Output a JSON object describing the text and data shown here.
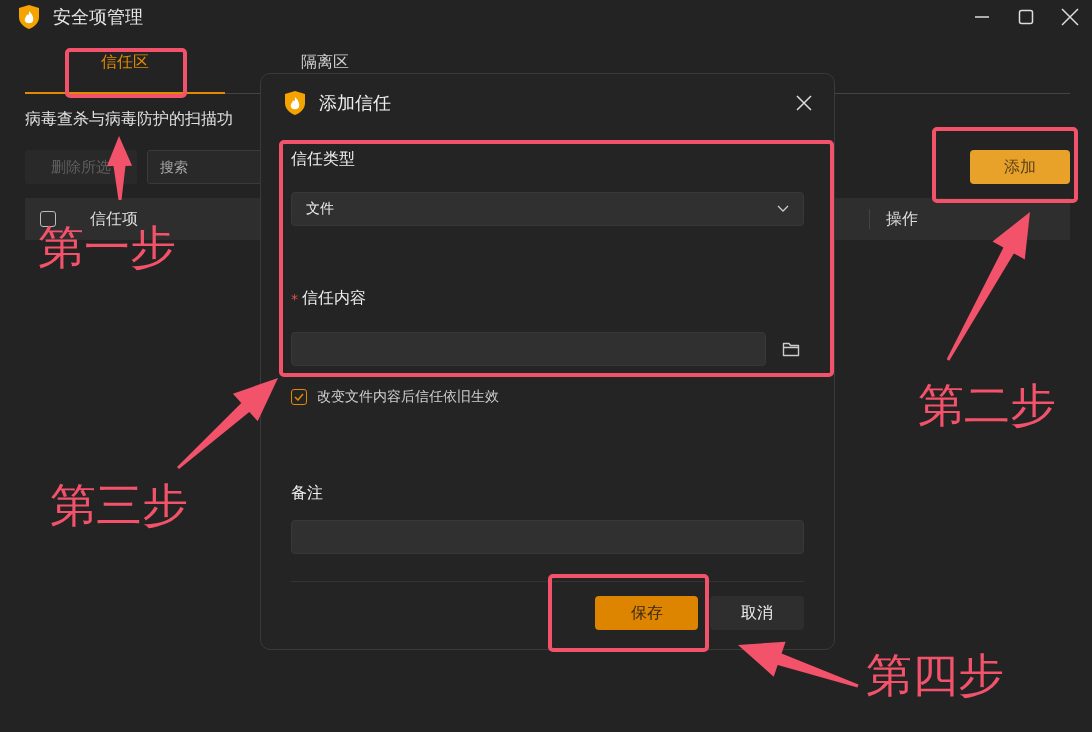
{
  "window": {
    "title": "安全项管理"
  },
  "tabs": [
    {
      "label": "信任区",
      "selected": true
    },
    {
      "label": "隔离区",
      "selected": false
    }
  ],
  "description": "病毒查杀与病毒防护的扫描功",
  "toolbar": {
    "delete_button": {
      "label": "删除所选",
      "disabled": true
    },
    "search": {
      "placeholder": "搜索"
    },
    "add_button": "添加"
  },
  "table": {
    "columns": [
      "信任项",
      "操作"
    ],
    "select_all_checked": false
  },
  "dialog": {
    "title": "添加信任",
    "type_label": "信任类型",
    "type_value": "文件",
    "content_label": "信任内容",
    "content_required": true,
    "required_mark": "*",
    "keep_trust": {
      "label": "改变文件内容后信任依旧生效",
      "checked": true
    },
    "note_label": "备注",
    "buttons": [
      {
        "label": "保存",
        "kind": "primary"
      },
      {
        "label": "取消",
        "kind": "secondary"
      }
    ]
  },
  "annotations": [
    {
      "label": "第一步"
    },
    {
      "label": "第二步"
    },
    {
      "label": "第三步"
    },
    {
      "label": "第四步"
    }
  ]
}
